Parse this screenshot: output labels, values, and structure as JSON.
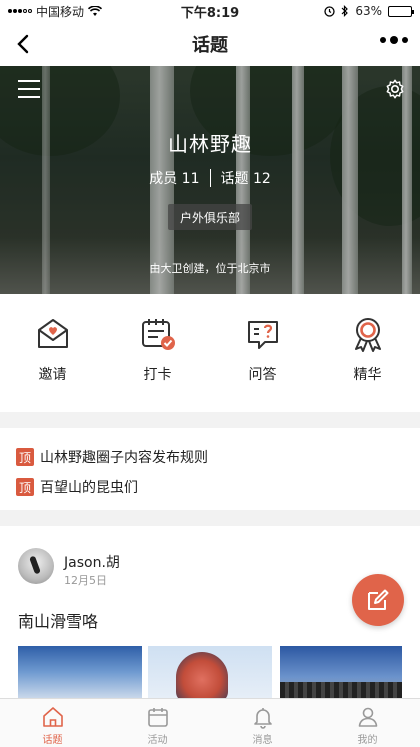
{
  "status_bar": {
    "carrier": "中国移动",
    "time": "下午8:19",
    "battery_percent": "63%",
    "battery_level": 0.63
  },
  "nav": {
    "title": "话题"
  },
  "group": {
    "name": "山林野趣",
    "members_label": "成员",
    "members_count": "11",
    "topics_label": "话题",
    "topics_count": "12",
    "category": "户外俱乐部",
    "creator_info": "由大卫创建，位于北京市"
  },
  "features": [
    {
      "label": "邀请",
      "icon": "envelope-heart-icon"
    },
    {
      "label": "打卡",
      "icon": "calendar-check-icon"
    },
    {
      "label": "问答",
      "icon": "chat-question-icon"
    },
    {
      "label": "精华",
      "icon": "award-ribbon-icon"
    }
  ],
  "pinned": {
    "badge": "顶",
    "items": [
      "山林野趣圈子内容发布规则",
      "百望山的昆虫们"
    ]
  },
  "post": {
    "author": "Jason.胡",
    "date": "12月5日",
    "title": "南山滑雪咯"
  },
  "tabs": [
    {
      "label": "话题",
      "icon": "home-icon",
      "active": true
    },
    {
      "label": "活动",
      "icon": "calendar-icon",
      "active": false
    },
    {
      "label": "消息",
      "icon": "bell-icon",
      "active": false
    },
    {
      "label": "我的",
      "icon": "person-icon",
      "active": false
    }
  ],
  "colors": {
    "accent": "#e0644a",
    "pin_badge": "#d95a3f"
  }
}
